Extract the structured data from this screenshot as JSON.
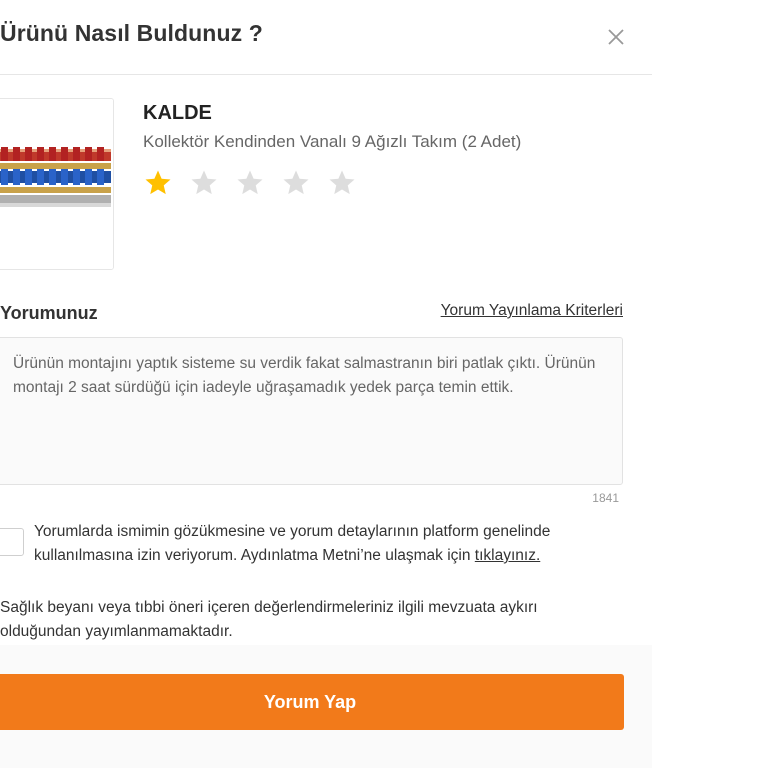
{
  "modal": {
    "title": "Ürünü Nasıl Buldunuz ?",
    "close_icon": "close-icon"
  },
  "product": {
    "brand": "KALDE",
    "name": "Kollektör Kendinden Vanalı 9 Ağızlı Takım (2 Adet)",
    "image_icon": "product-image",
    "rating": {
      "value": 1,
      "max": 5
    }
  },
  "review": {
    "label": "Yorumunuz",
    "criteria_link": "Yorum Yayınlama Kriterleri",
    "text": "Ürünün montajını yaptık sisteme su verdik fakat salmastranın biri patlak çıktı. Ürünün montajı 2 saat sürdüğü için iadeyle uğraşamadık yedek parça temin ettik.",
    "char_count": "1841"
  },
  "consent": {
    "checked": false,
    "text": "Yorumlarda ismimin gözükmesine ve yorum detaylarının platform genelinde kullanılmasına izin veriyorum. Aydınlatma Metni’ne ulaşmak için ",
    "link": "tıklayınız."
  },
  "disclaimer": "Sağlık beyanı veya tıbbi öneri içeren değerlendirmeleriniz ilgili mevzuata aykırı olduğundan yayımlanmamaktadır.",
  "submit_label": "Yorum Yap",
  "colors": {
    "accent": "#f27a1a",
    "star_filled": "#ffc000",
    "star_empty": "#dddddd",
    "text": "#333333",
    "muted": "#666666"
  }
}
